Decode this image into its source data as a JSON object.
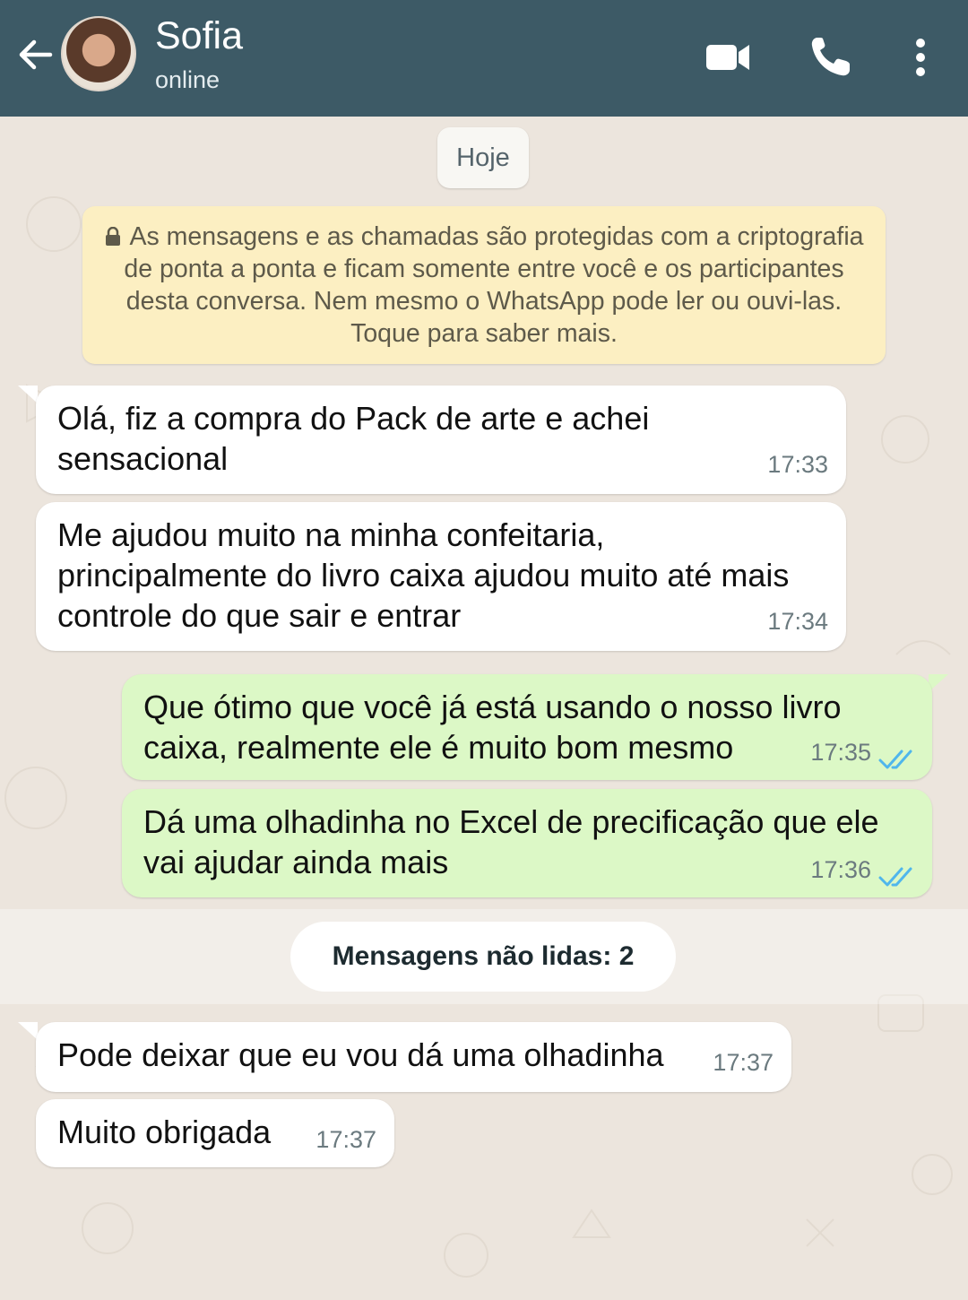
{
  "header": {
    "contact_name": "Sofia",
    "status": "online",
    "colors": {
      "bar": "#3d5a66"
    },
    "icons": [
      "back-arrow-icon",
      "video-call-icon",
      "phone-call-icon",
      "more-options-icon"
    ]
  },
  "chat": {
    "date_label": "Hoje",
    "encryption_notice": "As mensagens e as chamadas são protegidas com a criptografia de ponta a ponta e ficam somente entre você e os participantes desta conversa. Nem mesmo o WhatsApp pode ler ou ouvi-las. Toque para saber mais.",
    "unread_label": "Mensagens não lidas: 2",
    "messages": [
      {
        "direction": "incoming",
        "line1": "Olá, fiz a compra do Pack de arte e achei",
        "line2": "sensacional",
        "time": "17:33"
      },
      {
        "direction": "incoming",
        "line1": "Me ajudou muito na minha confeitaria,",
        "line2": "principalmente do livro caixa ajudou muito até mais",
        "line3": "controle do que sair e entrar",
        "time": "17:34"
      },
      {
        "direction": "outgoing",
        "line1": "Que ótimo que você já está usando o nosso livro",
        "line2": "caixa, realmente ele é muito bom mesmo",
        "time": "17:35",
        "status": "read"
      },
      {
        "direction": "outgoing",
        "line1": "Dá uma olhadinha no Excel de precificação que ele",
        "line2": "vai ajudar ainda mais",
        "time": "17:36",
        "status": "read"
      },
      {
        "direction": "incoming",
        "line1": "Pode deixar que eu vou dá uma olhadinha",
        "time": "17:37"
      },
      {
        "direction": "incoming",
        "line1": "Muito obrigada",
        "time": "17:37"
      }
    ],
    "colors": {
      "incoming": "#ffffff",
      "outgoing": "#dcf8c6",
      "read_ticks": "#4fb6ec",
      "notice": "#fcefc2"
    }
  }
}
